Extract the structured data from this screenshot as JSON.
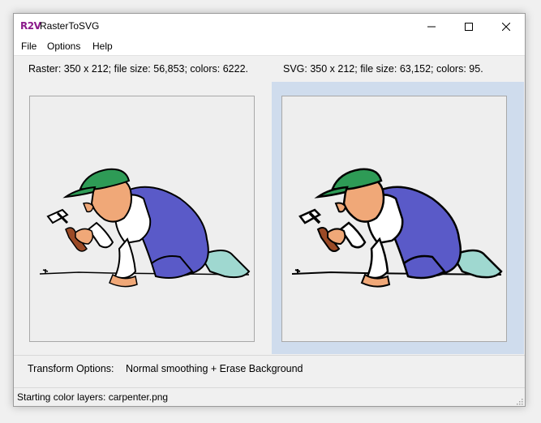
{
  "window": {
    "app_icon_text": "R2V",
    "title": "RasterToSVG",
    "controls": {
      "minimize_icon": "minimize-icon",
      "maximize_icon": "maximize-icon",
      "close_icon": "close-icon"
    }
  },
  "menu": [
    "File",
    "Options",
    "Help"
  ],
  "info": {
    "raster": "Raster: 350 x 212; file size: 56,853; colors: 6222.",
    "svg": "SVG: 350 x 212; file size: 63,152; colors: 95."
  },
  "panels": {
    "left": {
      "image": "carpenter-raster-image"
    },
    "right": {
      "image": "carpenter-svg-image",
      "selected": true
    }
  },
  "transform": {
    "label": "Transform Options:",
    "value": "Normal smoothing + Erase Background"
  },
  "status": "Starting color layers: carpenter.png",
  "colors": {
    "selected_panel_bg": "#cfdced",
    "cap": "#2e9b56",
    "overalls": "#5a5ac8",
    "skin": "#f0a878",
    "shoes": "#9fd8d0",
    "hammer_handle": "#9b4a26"
  }
}
